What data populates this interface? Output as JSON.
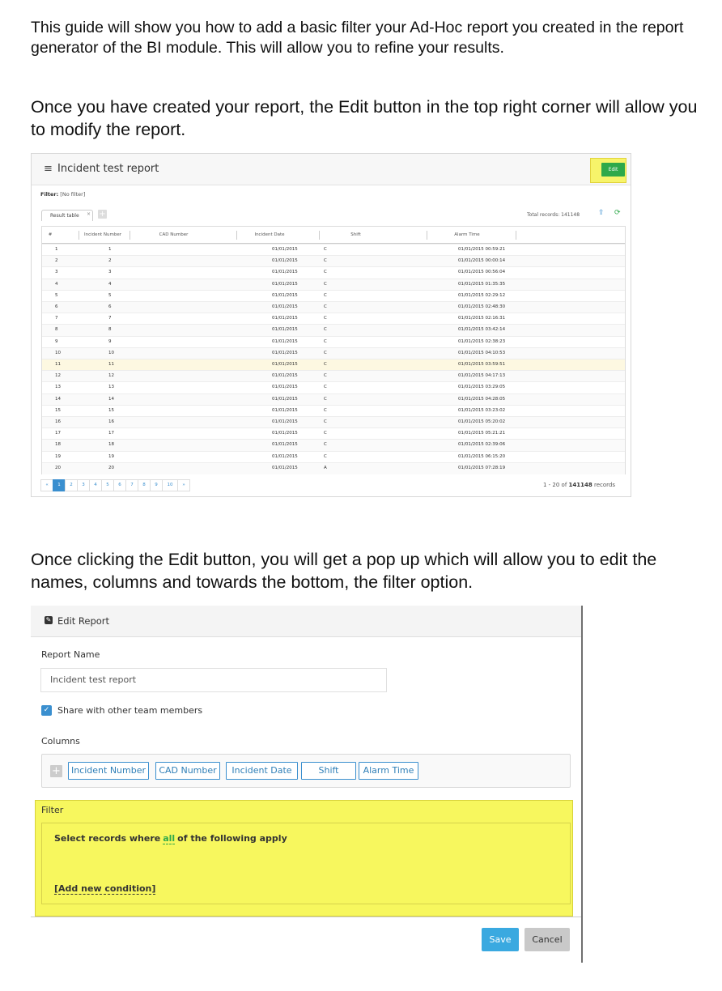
{
  "paragraphs": {
    "intro": "This guide will show you how to add a basic filter your Ad-Hoc report you created in the report generator of the BI module. This will allow you to refine your results.",
    "edit_step": "Once you have created your report, the Edit button in the top right corner will allow you to modify the report.",
    "popup_step": "Once clicking the Edit button, you will get a pop up which will allow you to edit the names, columns and towards the bottom, the filter option."
  },
  "report_screen": {
    "title": "Incident test report",
    "edit_label": "Edit",
    "filter_label": "Filter:",
    "filter_value": "[No filter]",
    "tab_label": "Result table",
    "total_label": "Total records:",
    "total_value": "141148",
    "headers": [
      "#",
      "Incident Number",
      "CAD Number",
      "Incident Date",
      "Shift",
      "Alarm Time"
    ],
    "rows": [
      [
        "1",
        "1",
        "",
        "01/01/2015",
        "C",
        "01/01/2015 00:59:21"
      ],
      [
        "2",
        "2",
        "",
        "01/01/2015",
        "C",
        "01/01/2015 00:00:14"
      ],
      [
        "3",
        "3",
        "",
        "01/01/2015",
        "C",
        "01/01/2015 00:56:04"
      ],
      [
        "4",
        "4",
        "",
        "01/01/2015",
        "C",
        "01/01/2015 01:35:35"
      ],
      [
        "5",
        "5",
        "",
        "01/01/2015",
        "C",
        "01/01/2015 02:29:12"
      ],
      [
        "6",
        "6",
        "",
        "01/01/2015",
        "C",
        "01/01/2015 02:48:30"
      ],
      [
        "7",
        "7",
        "",
        "01/01/2015",
        "C",
        "01/01/2015 02:16:31"
      ],
      [
        "8",
        "8",
        "",
        "01/01/2015",
        "C",
        "01/01/2015 03:42:14"
      ],
      [
        "9",
        "9",
        "",
        "01/01/2015",
        "C",
        "01/01/2015 02:38:23"
      ],
      [
        "10",
        "10",
        "",
        "01/01/2015",
        "C",
        "01/01/2015 04:10:53"
      ],
      [
        "11",
        "11",
        "",
        "01/01/2015",
        "C",
        "01/01/2015 03:59:51"
      ],
      [
        "12",
        "12",
        "",
        "01/01/2015",
        "C",
        "01/01/2015 04:17:13"
      ],
      [
        "13",
        "13",
        "",
        "01/01/2015",
        "C",
        "01/01/2015 03:29:05"
      ],
      [
        "14",
        "14",
        "",
        "01/01/2015",
        "C",
        "01/01/2015 04:28:05"
      ],
      [
        "15",
        "15",
        "",
        "01/01/2015",
        "C",
        "01/01/2015 03:23:02"
      ],
      [
        "16",
        "16",
        "",
        "01/01/2015",
        "C",
        "01/01/2015 05:20:02"
      ],
      [
        "17",
        "17",
        "",
        "01/01/2015",
        "C",
        "01/01/2015 05:21:21"
      ],
      [
        "18",
        "18",
        "",
        "01/01/2015",
        "C",
        "01/01/2015 02:39:06"
      ],
      [
        "19",
        "19",
        "",
        "01/01/2015",
        "C",
        "01/01/2015 06:15:20"
      ],
      [
        "20",
        "20",
        "",
        "01/01/2015",
        "A",
        "01/01/2015 07:28:19"
      ]
    ],
    "pager": [
      "«",
      "1",
      "2",
      "3",
      "4",
      "5",
      "6",
      "7",
      "8",
      "9",
      "10",
      "»"
    ],
    "range_text": "1 - 20 of",
    "range_total": "141148",
    "range_suffix": "records"
  },
  "edit_dialog": {
    "title": "Edit Report",
    "report_name_label": "Report Name",
    "report_name_value": "Incident test report",
    "share_label": "Share with other team members",
    "columns_label": "Columns",
    "columns": [
      "Incident Number",
      "CAD Number",
      "Incident Date",
      "Shift",
      "Alarm Time"
    ],
    "filter_label": "Filter",
    "select_prefix": "Select records where",
    "select_all": "all",
    "select_suffix": "of the following apply",
    "add_condition": "[Add new condition]",
    "save_label": "Save",
    "cancel_label": "Cancel"
  }
}
